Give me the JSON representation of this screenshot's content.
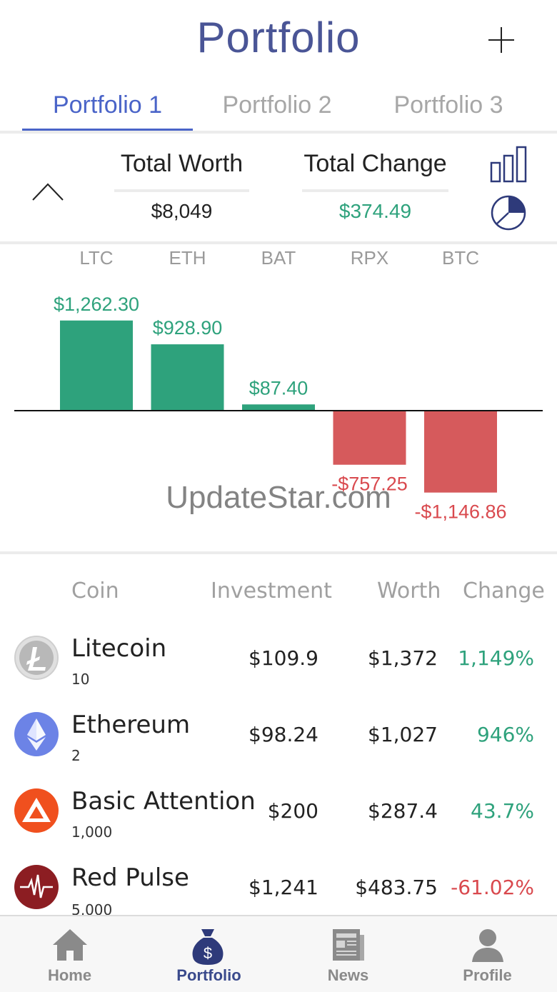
{
  "header": {
    "title": "Portfolio"
  },
  "tabs": [
    {
      "label": "Portfolio 1",
      "active": true
    },
    {
      "label": "Portfolio 2",
      "active": false
    },
    {
      "label": "Portfolio 3",
      "active": false
    }
  ],
  "summary": {
    "total_worth_label": "Total Worth",
    "total_worth_value": "$8,049",
    "total_change_label": "Total Change",
    "total_change_value": "$374.49"
  },
  "chart_data": {
    "type": "bar",
    "categories": [
      "LTC",
      "ETH",
      "BAT",
      "RPX",
      "BTC"
    ],
    "values": [
      1262.3,
      928.9,
      87.4,
      -757.25,
      -1146.86
    ],
    "value_labels": [
      "$1,262.30",
      "$928.90",
      "$87.40",
      "-$757.25",
      "-$1,146.86"
    ],
    "colors": {
      "positive": "#2ea27c",
      "negative": "#d65a5c"
    }
  },
  "watermark": "UpdateStar.com",
  "table": {
    "headers": {
      "coin": "Coin",
      "investment": "Investment",
      "worth": "Worth",
      "change": "Change"
    },
    "rows": [
      {
        "name": "Litecoin",
        "qty": "10",
        "investment": "$109.9",
        "worth": "$1,372",
        "change": "1,149%",
        "direction": "pos",
        "icon": "litecoin-icon"
      },
      {
        "name": "Ethereum",
        "qty": "2",
        "investment": "$98.24",
        "worth": "$1,027",
        "change": "946%",
        "direction": "pos",
        "icon": "ethereum-icon"
      },
      {
        "name": "Basic Attention",
        "qty": "1,000",
        "investment": "$200",
        "worth": "$287.4",
        "change": "43.7%",
        "direction": "pos",
        "icon": "bat-icon"
      },
      {
        "name": "Red Pulse",
        "qty": "5,000",
        "investment": "$1,241",
        "worth": "$483.75",
        "change": "-61.02%",
        "direction": "neg",
        "icon": "red-pulse-icon"
      }
    ]
  },
  "nav": {
    "items": [
      {
        "label": "Home",
        "icon": "home-icon",
        "active": false
      },
      {
        "label": "Portfolio",
        "icon": "money-bag-icon",
        "active": true
      },
      {
        "label": "News",
        "icon": "newspaper-icon",
        "active": false
      },
      {
        "label": "Profile",
        "icon": "user-icon",
        "active": false
      }
    ]
  },
  "colors": {
    "accent": "#4a64c8",
    "title": "#4a5596",
    "positive": "#2ea27c",
    "negative": "#d9494e"
  }
}
